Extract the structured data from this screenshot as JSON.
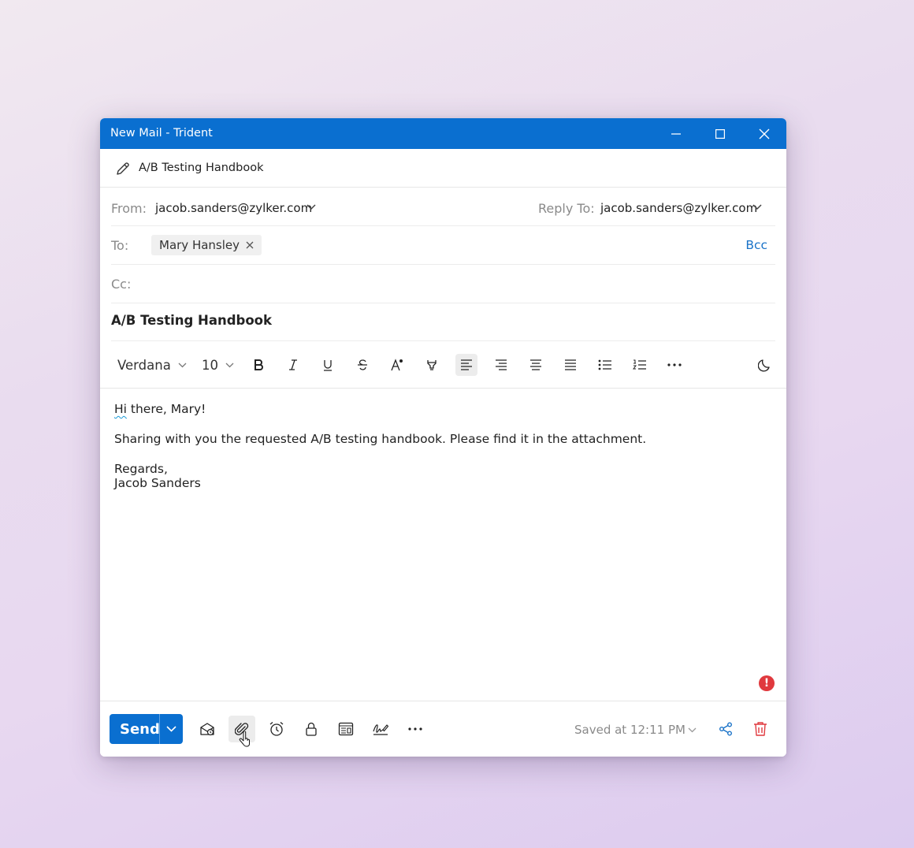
{
  "window": {
    "title": "New Mail - Trident",
    "controls": [
      "minimize-icon",
      "maximize-icon",
      "close-icon"
    ]
  },
  "draft_header": {
    "icon": "pencil-icon",
    "subject": "A/B Testing Handbook"
  },
  "from": {
    "label": "From:",
    "value": "jacob.sanders@zylker.com"
  },
  "reply_to": {
    "label": "Reply To:",
    "value": "jacob.sanders@zylker.com"
  },
  "to": {
    "label": "To:",
    "recipients": [
      "Mary Hansley"
    ],
    "bcc_label": "Bcc"
  },
  "cc": {
    "label": "Cc:"
  },
  "subject": {
    "value": "A/B Testing Handbook"
  },
  "formatting": {
    "font_family": "Verdana",
    "font_size": "10",
    "tools": [
      "bold-icon",
      "italic-icon",
      "underline-icon",
      "strikethrough-icon",
      "font-color-icon",
      "highlight-icon",
      "align-left-icon",
      "align-right-icon",
      "align-center-icon",
      "align-justify-icon",
      "bullet-list-icon",
      "numbered-list-icon",
      "more-icon",
      "dark-mode-icon"
    ],
    "active_tool": "align-left-icon"
  },
  "body": {
    "greeting_word": "Hi",
    "greeting_rest": " there, Mary!",
    "paragraph": "Sharing with you the requested A/B testing handbook. Please find it in the attachment.",
    "signoff": "Regards,",
    "signature": "Jacob Sanders"
  },
  "alert": {
    "symbol": "!"
  },
  "footer": {
    "send_label": "Send",
    "tools": [
      "read-receipt-icon",
      "attachment-icon",
      "reminder-icon",
      "encrypt-icon",
      "template-icon",
      "signature-icon",
      "more-icon"
    ],
    "hovered_tool": "attachment-icon",
    "saved_status": "Saved at 12:11 PM",
    "right_tools": [
      "share-icon",
      "delete-icon"
    ]
  },
  "colors": {
    "accent": "#0a6fd0",
    "link": "#1a73c8",
    "danger": "#e0393e"
  }
}
